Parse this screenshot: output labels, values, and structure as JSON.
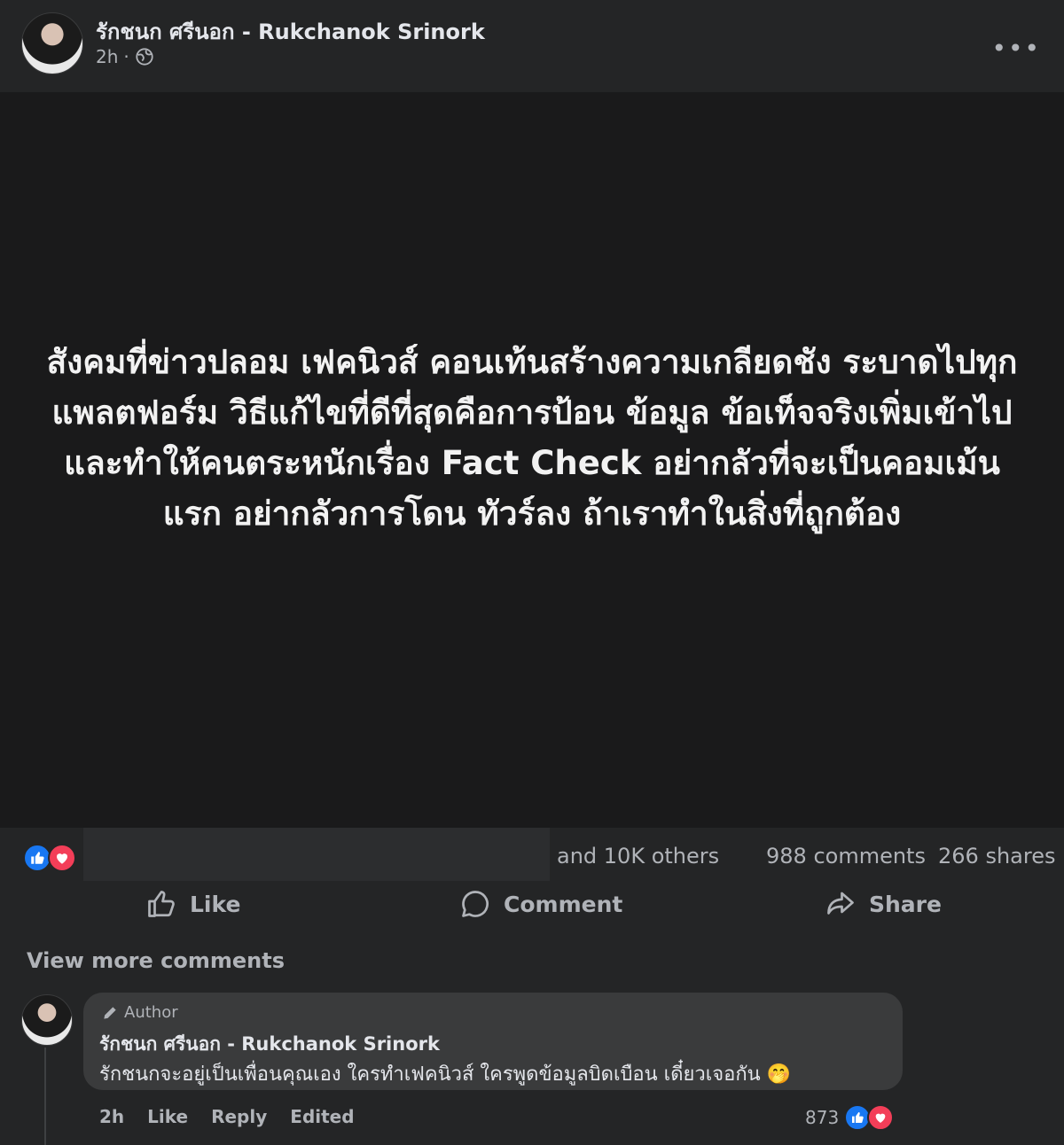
{
  "post": {
    "author": "รักชนก ศรีนอก - Rukchanok Srinork",
    "time": "2h",
    "separator": "·",
    "privacy_icon": "globe-icon",
    "more_label": "•••",
    "text": "สังคมที่ข่าวปลอม เฟคนิวส์ คอนเท้นสร้างความเกลียดชัง ระบาดไปทุกแพลตฟอร์ม วิธีแก้ไขที่ดีที่สุดคือการป้อน ข้อมูล ข้อเท็จจริงเพิ่มเข้าไป และทำให้คนตระหนักเรื่อง Fact Check อย่ากลัวที่จะเป็นคอมเม้นแรก อย่ากลัวการโดน ทัวร์ลง ถ้าเราทำในสิ่งที่ถูกต้อง"
  },
  "stats": {
    "others": "and 10K others",
    "comments": "988 comments",
    "shares": "266 shares",
    "reaction_icons": [
      "like-reaction-icon",
      "love-reaction-icon"
    ]
  },
  "actions": {
    "like": "Like",
    "comment": "Comment",
    "share": "Share"
  },
  "comments": {
    "view_more": "View more comments",
    "items": [
      {
        "badge": "Author",
        "author": "รักชนก ศรีนอก - Rukchanok Srinork",
        "text": "รักชนกจะอยู่เป็นเพื่อนคุณเอง ใครทำเฟคนิวส์ ใครพูดข้อมูลบิดเบือน เดี๋ยวเจอกัน 🤭",
        "time": "2h",
        "like": "Like",
        "reply": "Reply",
        "edited": "Edited",
        "reactions_count": "873"
      }
    ]
  },
  "colors": {
    "background": "#18191a",
    "card": "#242526",
    "like_blue": "#1877f2",
    "love_red": "#f33e58",
    "text_secondary": "#b0b3b8"
  }
}
